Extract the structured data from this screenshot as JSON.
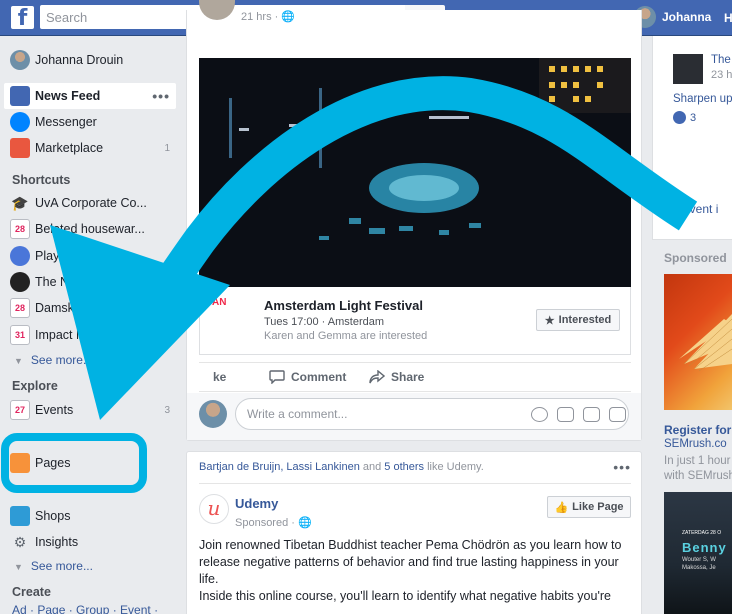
{
  "topbar": {
    "logo": "f",
    "search_placeholder": "Search",
    "user_name": "Johanna",
    "trailing_letter": "H",
    "icons": {
      "logo": "facebook-logo",
      "search": "magnifier-icon"
    }
  },
  "left_nav": {
    "profile_name": "Johanna Drouin",
    "main_items": [
      {
        "label": "News Feed",
        "dots": "•••"
      },
      {
        "label": "Messenger"
      },
      {
        "label": "Marketplace",
        "count": "1"
      }
    ],
    "shortcuts_heading": "Shortcuts",
    "shortcuts": [
      {
        "label": "UvA Corporate Co..."
      },
      {
        "label": "Belated housewar...",
        "calendar_day": "28"
      },
      {
        "label": "Playground"
      },
      {
        "label": "The Next Ac"
      },
      {
        "label": "Damsko Hal",
        "calendar_day": "28"
      },
      {
        "label": "Impact Night",
        "calendar_day": "31"
      }
    ],
    "see_more_1": "See more...",
    "explore_heading": "Explore",
    "explore": [
      {
        "label": "Events",
        "count": "3",
        "calendar_day": "27"
      },
      {
        "label": "Pages"
      },
      {
        "label": "Shops"
      },
      {
        "label": "Insights"
      }
    ],
    "see_more_2": "See more...",
    "create_heading": "Create",
    "create_links": "Ad · Page · Group · Event ·"
  },
  "post1": {
    "time": "21 hrs · ",
    "event": {
      "date_fragment": "AN",
      "title": "Amsterdam Light Festival",
      "when": "Tues 17:00 · Amsterdam",
      "interested_line": "Karen and Gemma are interested",
      "interested_button": "Interested"
    },
    "actions": {
      "like_fragment": "ke",
      "comment": "Comment",
      "share": "Share"
    },
    "comment_placeholder": "Write a comment..."
  },
  "post2": {
    "liked_by_names": "Bartjan de Bruijn, Lassi Lankinen",
    "liked_by_suffix": " and ",
    "liked_by_others": "5 others",
    "liked_by_tail": " like Udemy.",
    "dots": "•••",
    "page_name": "Udemy",
    "sponsored": "Sponsored · ",
    "like_page_button": "Like Page",
    "body": "Join renowned Tibetan Buddhist teacher Pema Chödrön as you learn how to release negative patterns of behavior and find true lasting happiness in your life.",
    "body2": "Inside this online course, you'll learn to identify what negative habits you're"
  },
  "right": {
    "card1": {
      "title_fragment": "The",
      "time_fragment": "23 h",
      "link": "Sharpen up y",
      "likes": "3",
      "event_fragment": "event i"
    },
    "sponsored_heading": "Sponsored",
    "ad1": {
      "title": "Register for",
      "url": "SEMrush.co",
      "desc_line1": "In just 1 hour",
      "desc_line2": "with SEMrush"
    },
    "ad2": {
      "line1": "ZATERDAG 28 O",
      "name": "Benny",
      "line2": "Wouter S, W",
      "line3": "Makossa, Je"
    }
  },
  "annotation": {
    "arrow_color": "#00b2e3",
    "highlight_target": "Pages"
  },
  "colors": {
    "fb_blue": "#4267b2",
    "link": "#365899",
    "annotation": "#00b2e3"
  }
}
